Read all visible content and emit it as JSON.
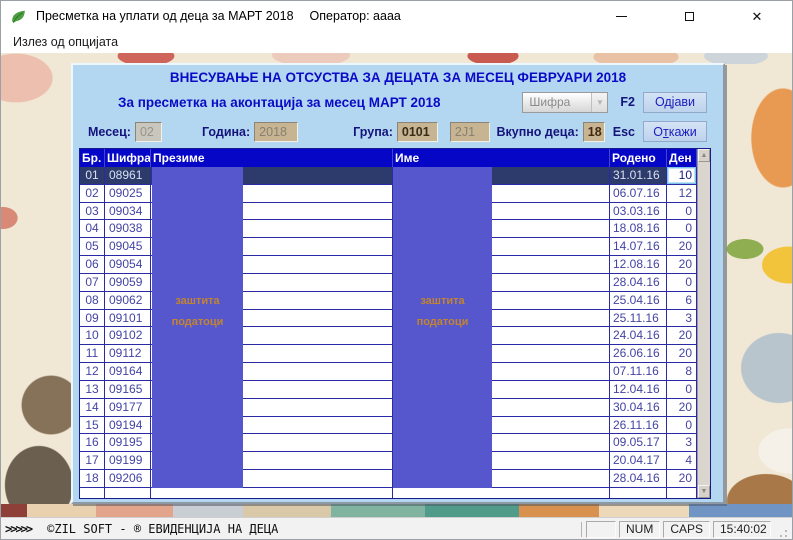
{
  "window": {
    "title": "Пресметка на уплати од деца за МАРТ 2018",
    "operator": "Оператор: аааа"
  },
  "icons": {
    "app": "leaf-icon",
    "minimize": "—",
    "close": "✕",
    "combo_arrow": "▼",
    "scroll_up": "▲",
    "scroll_down": "▼"
  },
  "menu": {
    "exit_item": "Излез од опцијата"
  },
  "panel": {
    "title1": "ВНЕСУВАЊЕ НА ОТСУСТВА ЗА ДЕЦАТА ЗА МЕСЕЦ ФЕВРУАРИ 2018",
    "title2": "За пресметка на аконтација за месец МАРТ 2018",
    "combo_value": "Шифра",
    "f2_label": "F2",
    "logout_button": "Одјави",
    "esc_label": "Esc",
    "cancel_pre": "О",
    "cancel_hot": "т",
    "cancel_post": "кажи",
    "fields": {
      "month_label": "Месец:",
      "month_value": "02",
      "year_label": "Година:",
      "year_value": "2018",
      "group_label": "Група:",
      "group_code": "0101",
      "group_name": "2Ј1",
      "total_label": "Вкупно деца:",
      "total_value": "18"
    }
  },
  "table": {
    "headers": [
      "Бр.",
      "Шифра",
      "Презиме",
      "Име",
      "Родено",
      "Ден"
    ],
    "privacy_overlay": {
      "line1": "заштита",
      "line2": "податоци"
    },
    "selected_index": 0,
    "rows": [
      {
        "num": "01",
        "code": "08961",
        "surname": "",
        "name": "",
        "born": "31.01.16",
        "days": "10"
      },
      {
        "num": "02",
        "code": "09025",
        "surname": "",
        "name": "",
        "born": "06.07.16",
        "days": "12"
      },
      {
        "num": "03",
        "code": "09034",
        "surname": "",
        "name": "",
        "born": "03.03.16",
        "days": "0"
      },
      {
        "num": "04",
        "code": "09038",
        "surname": "",
        "name": "",
        "born": "18.08.16",
        "days": "0"
      },
      {
        "num": "05",
        "code": "09045",
        "surname": "",
        "name": "",
        "born": "14.07.16",
        "days": "20"
      },
      {
        "num": "06",
        "code": "09054",
        "surname": "",
        "name": "",
        "born": "12.08.16",
        "days": "20"
      },
      {
        "num": "07",
        "code": "09059",
        "surname": "",
        "name": "",
        "born": "28.04.16",
        "days": "0"
      },
      {
        "num": "08",
        "code": "09062",
        "surname": "",
        "name": "",
        "born": "25.04.16",
        "days": "6"
      },
      {
        "num": "09",
        "code": "09101",
        "surname": "",
        "name": "",
        "born": "25.11.16",
        "days": "3"
      },
      {
        "num": "10",
        "code": "09102",
        "surname": "",
        "name": "",
        "born": "24.04.16",
        "days": "20"
      },
      {
        "num": "11",
        "code": "09112",
        "surname": "",
        "name": "",
        "born": "26.06.16",
        "days": "20"
      },
      {
        "num": "12",
        "code": "09164",
        "surname": "",
        "name": "",
        "born": "07.11.16",
        "days": "8"
      },
      {
        "num": "13",
        "code": "09165",
        "surname": "",
        "name": "",
        "born": "12.04.16",
        "days": "0"
      },
      {
        "num": "14",
        "code": "09177",
        "surname": "",
        "name": "",
        "born": "30.04.16",
        "days": "20"
      },
      {
        "num": "15",
        "code": "09194",
        "surname": "",
        "name": "",
        "born": "26.11.16",
        "days": "0"
      },
      {
        "num": "16",
        "code": "09195",
        "surname": "",
        "name": "",
        "born": "09.05.17",
        "days": "3"
      },
      {
        "num": "17",
        "code": "09199",
        "surname": "",
        "name": "",
        "born": "20.04.17",
        "days": "4"
      },
      {
        "num": "18",
        "code": "09206",
        "surname": "",
        "name": "",
        "born": "28.04.16",
        "days": "20"
      }
    ]
  },
  "statusbar": {
    "arrows": ">>>>>",
    "copyright": "©ZIL SOFT - ® ЕВИДЕНЦИЈА НА ДЕЦА",
    "num": "NUM",
    "caps": "CAPS",
    "time": "15:40:02"
  }
}
